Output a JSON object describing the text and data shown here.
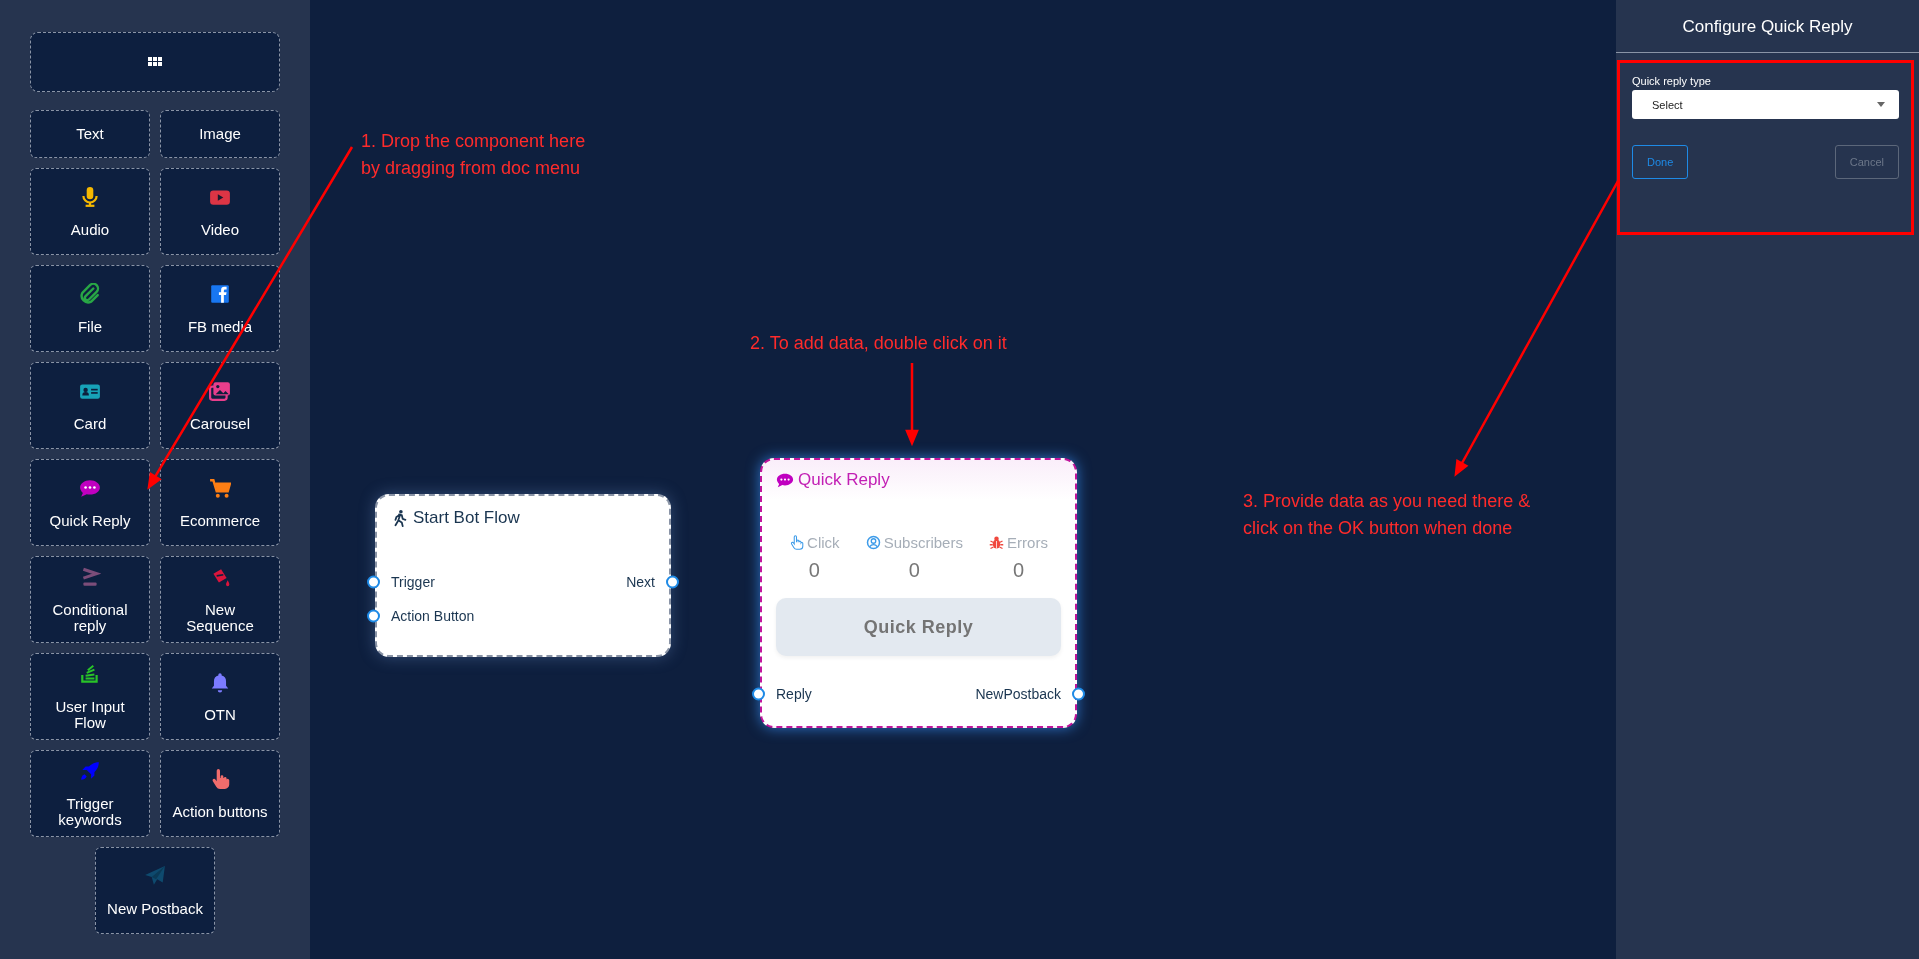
{
  "sidebar": {
    "tiles": [
      {
        "label": "Text",
        "kind": "text"
      },
      {
        "label": "Image",
        "kind": "image"
      },
      {
        "label": "Audio",
        "kind": "audio"
      },
      {
        "label": "Video",
        "kind": "video"
      },
      {
        "label": "File",
        "kind": "file"
      },
      {
        "label": "FB media",
        "kind": "fb"
      },
      {
        "label": "Card",
        "kind": "card"
      },
      {
        "label": "Carousel",
        "kind": "carousel"
      },
      {
        "label": "Quick Reply",
        "kind": "quickreply"
      },
      {
        "label": "Ecommerce",
        "kind": "ecommerce"
      },
      {
        "label": "Conditional reply",
        "kind": "conditional"
      },
      {
        "label": "New Sequence",
        "kind": "sequence"
      },
      {
        "label": "User Input Flow",
        "kind": "userinput"
      },
      {
        "label": "OTN",
        "kind": "otn"
      },
      {
        "label": "Trigger keywords",
        "kind": "trigger"
      },
      {
        "label": "Action buttons",
        "kind": "action"
      },
      {
        "label": "New Postback",
        "kind": "postback"
      }
    ]
  },
  "canvas": {
    "annotations": [
      {
        "text": "1. Drop the component here\nby dragging from doc menu"
      },
      {
        "text": "2. To add data, double click on it"
      },
      {
        "text": "3. Provide data as you need there &\nclick on the OK button when done"
      }
    ],
    "start_node": {
      "title": "Start Bot Flow",
      "inputs": [
        "Trigger",
        "Action Button"
      ],
      "outputs": [
        "Next"
      ]
    },
    "quick_reply_node": {
      "title": "Quick Reply",
      "stats": [
        {
          "kind": "click",
          "label": "Click",
          "value": "0"
        },
        {
          "kind": "subscribers",
          "label": "Subscribers",
          "value": "0"
        },
        {
          "kind": "errors",
          "label": "Errors",
          "value": "0"
        }
      ],
      "button": "Quick Reply",
      "inputs": [
        "Reply"
      ],
      "outputs": [
        "NewPostback"
      ]
    }
  },
  "panel": {
    "title": "Configure Quick Reply",
    "field_label": "Quick reply type",
    "select_value": "Select",
    "buttons": [
      {
        "label": "Done",
        "kind": "primary"
      },
      {
        "label": "Cancel",
        "kind": "secondary"
      }
    ]
  }
}
